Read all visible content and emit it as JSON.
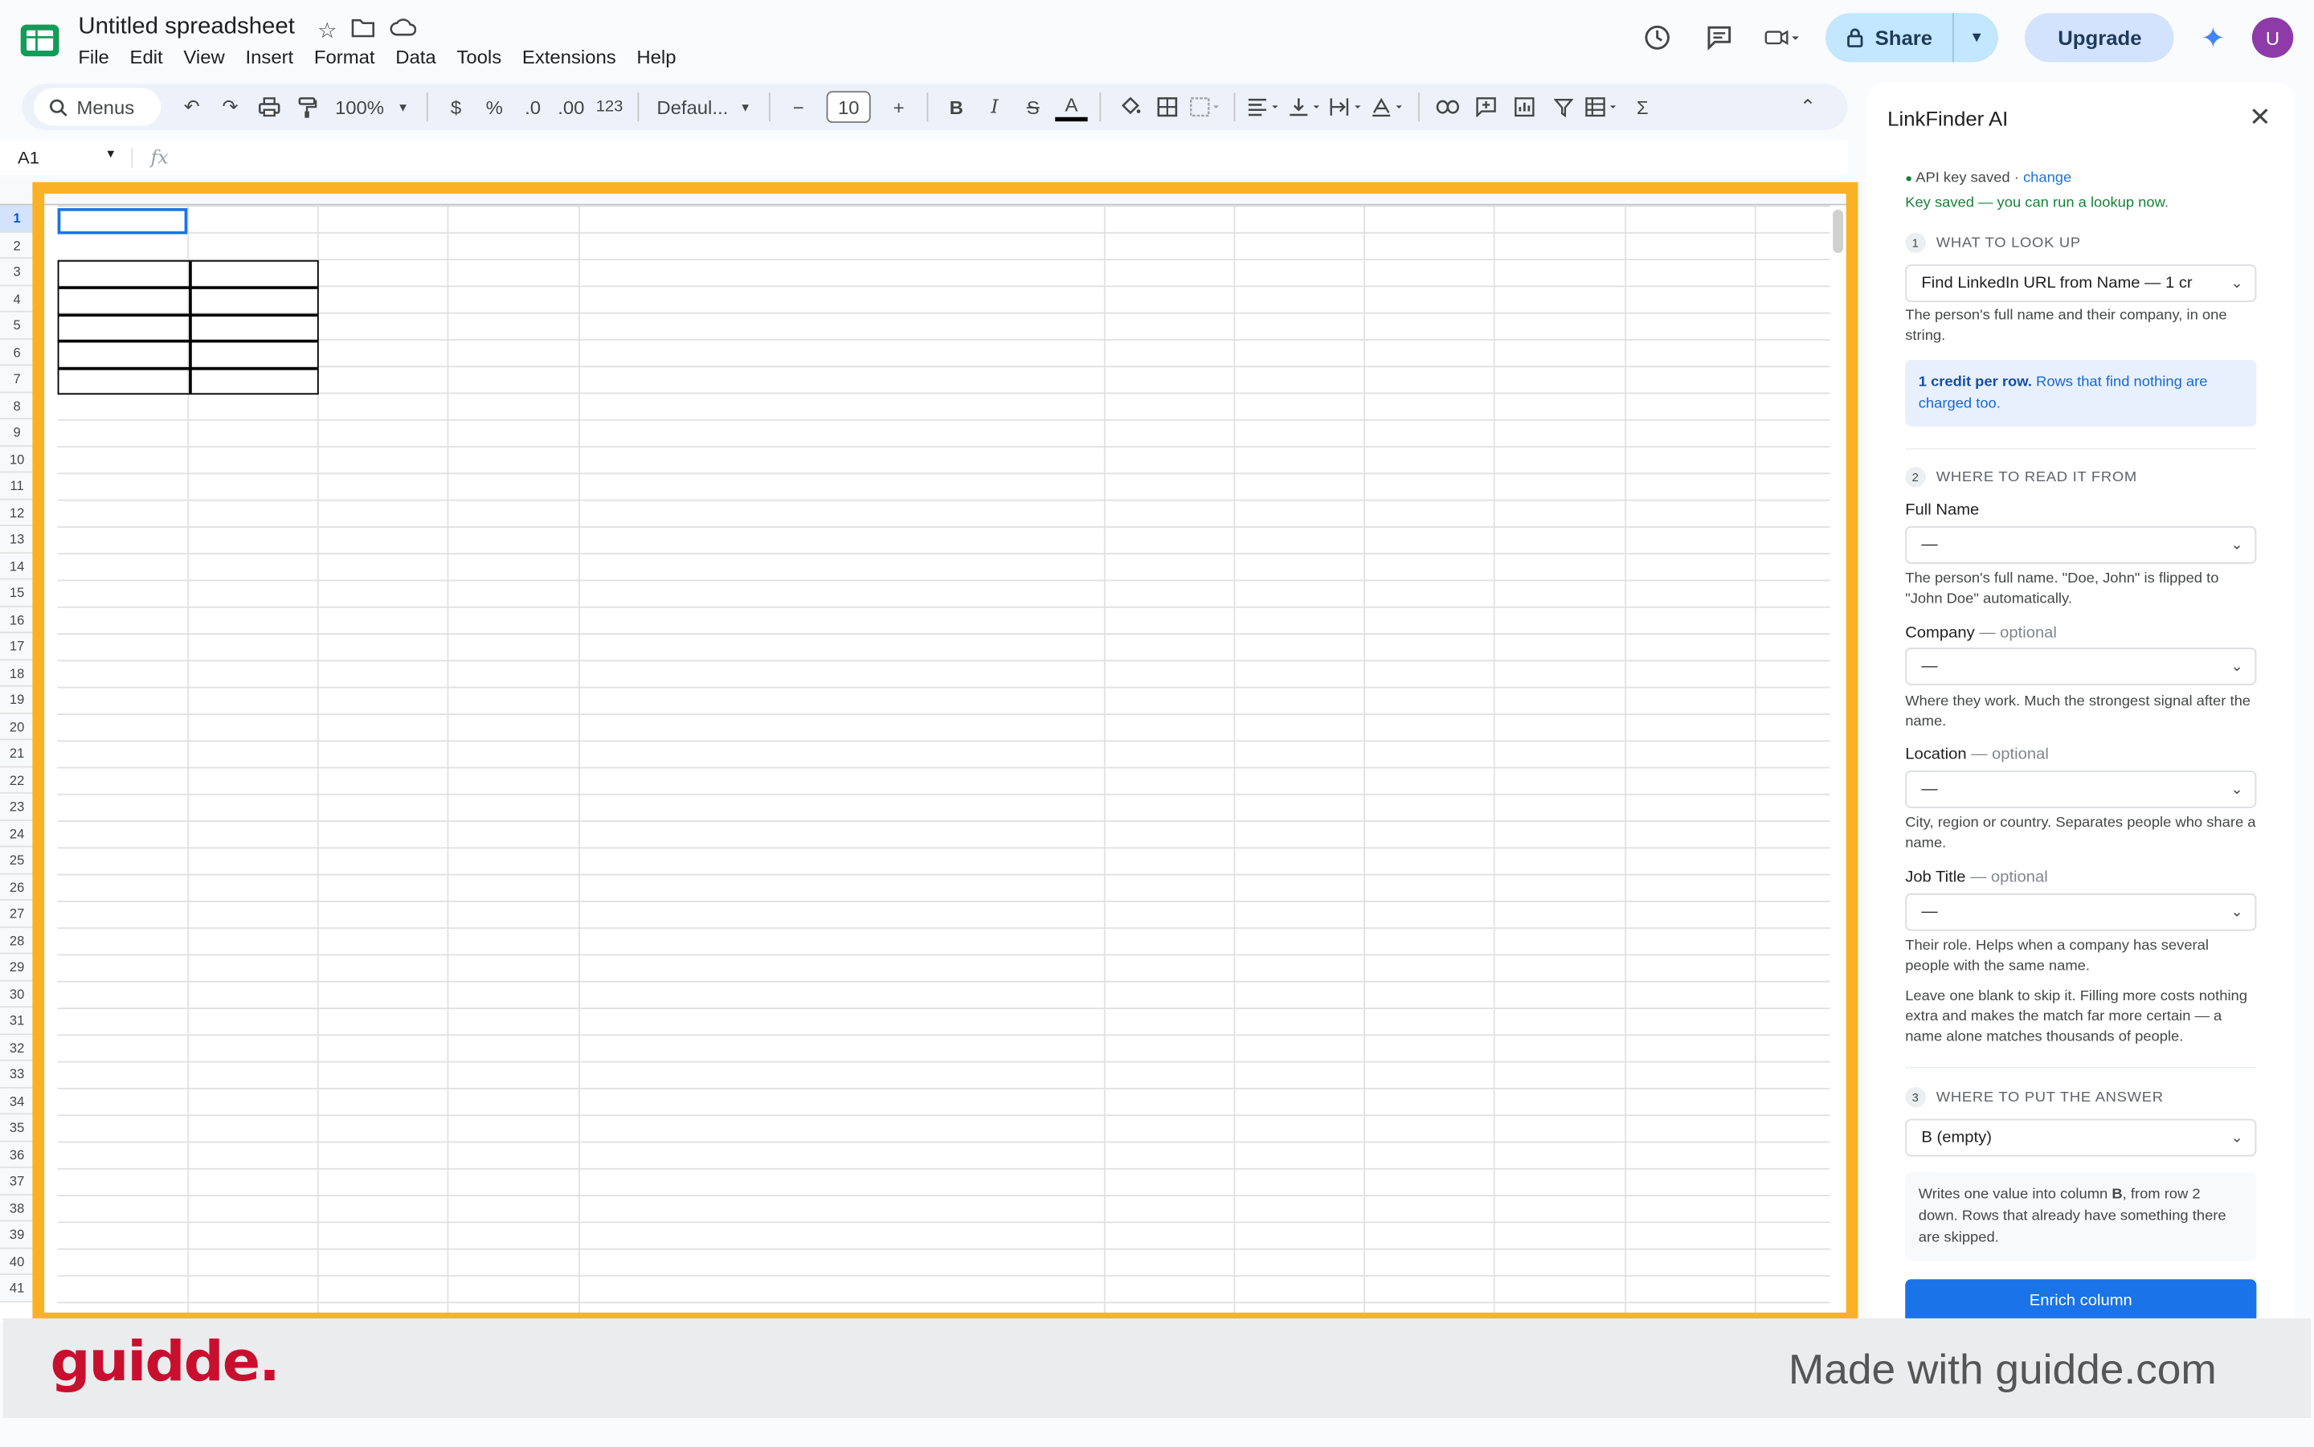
{
  "app": {
    "title": "Untitled spreadsheet",
    "menu": [
      "File",
      "Edit",
      "View",
      "Insert",
      "Format",
      "Data",
      "Tools",
      "Extensions",
      "Help"
    ],
    "share_label": "Share",
    "upgrade_label": "Upgrade",
    "avatar_letter": "U"
  },
  "toolbar": {
    "search_label": "Menus",
    "zoom": "100%",
    "currency": "$",
    "percent": "%",
    "dec_decrease": ".0",
    "dec_increase": ".00",
    "number_format": "123",
    "font": "Defaul...",
    "font_size": "10",
    "bold": "B",
    "italic": "I",
    "text_color": "A"
  },
  "formula_bar": {
    "cell_ref": "A1",
    "fx": "fx"
  },
  "grid": {
    "row_numbers": [
      "1",
      "2",
      "3",
      "4",
      "5",
      "6",
      "7",
      "8",
      "9",
      "10",
      "11",
      "12",
      "13",
      "14",
      "15",
      "16",
      "17",
      "18",
      "19",
      "20",
      "21",
      "22",
      "23",
      "24",
      "25",
      "26",
      "27",
      "28",
      "29",
      "30",
      "31",
      "32",
      "33",
      "34",
      "35",
      "36",
      "37",
      "38",
      "39",
      "40",
      "41"
    ]
  },
  "panel": {
    "title": "LinkFinder AI",
    "api_status": "API key saved ·",
    "api_change": "change",
    "key_saved": "Key saved — you can run a lookup now.",
    "step1": {
      "num": "1",
      "heading": "WHAT TO LOOK UP"
    },
    "lookup_select": "Find LinkedIn URL from Name — 1 cr",
    "lookup_help": "The person's full name and their company, in one string.",
    "credit_bold": "1 credit per row.",
    "credit_text": "Rows that find nothing are charged too.",
    "step2": {
      "num": "2",
      "heading": "WHERE TO READ IT FROM"
    },
    "full_name": {
      "label": "Full Name",
      "value": "—",
      "help": "The person's full name. \"Doe, John\" is flipped to \"John Doe\" automatically."
    },
    "company": {
      "label": "Company",
      "opt": "— optional",
      "value": "—",
      "help": "Where they work. Much the strongest signal after the name."
    },
    "location": {
      "label": "Location",
      "opt": "— optional",
      "value": "—",
      "help": "City, region or country. Separates people who share a name."
    },
    "job_title": {
      "label": "Job Title",
      "opt": "— optional",
      "value": "—",
      "help": "Their role. Helps when a company has several people with the same name."
    },
    "blank_note": "Leave one blank to skip it. Filling more costs nothing extra and makes the match far more certain — a name alone matches thousands of people.",
    "step3": {
      "num": "3",
      "heading": "WHERE TO PUT THE ANSWER"
    },
    "output_select": "B (empty)",
    "output_note_1": "Writes one value into column ",
    "output_note_col": "B",
    "output_note_2": ", from row 2 down. Rows that already have something there are skipped.",
    "enrich_label": "Enrich column"
  },
  "footer": {
    "logo": "guidde.",
    "made_with": "Made with guidde.com"
  },
  "colors": {
    "highlight": "#fbb124",
    "accent": "#1a73e8",
    "brand": "#c8102e"
  }
}
